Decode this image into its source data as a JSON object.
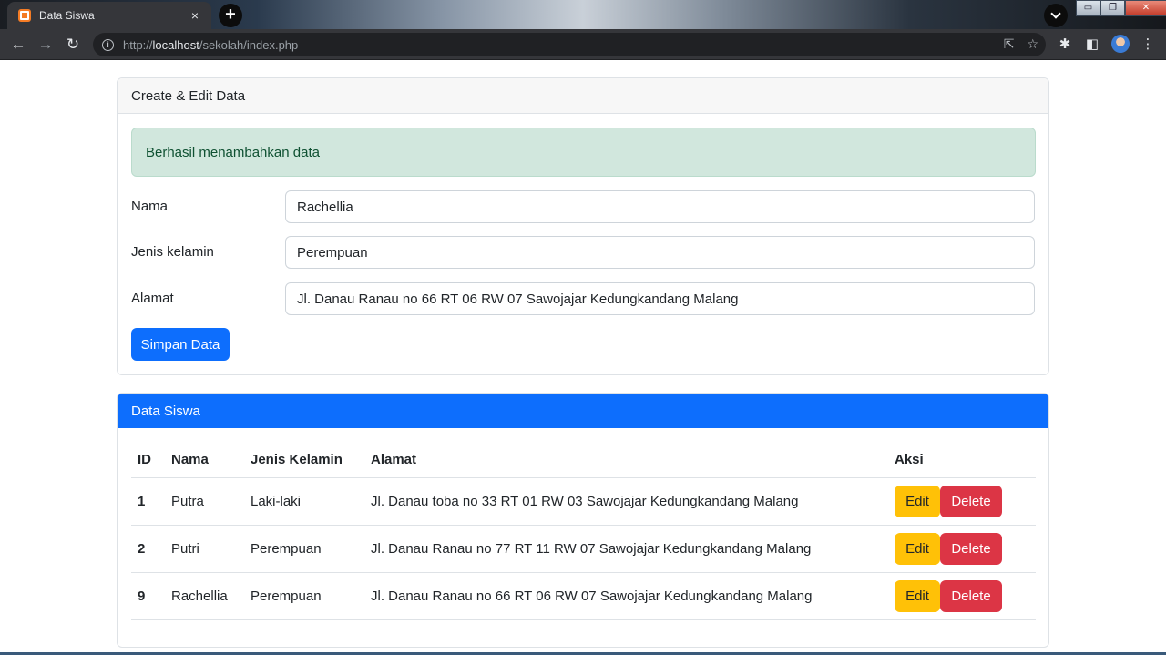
{
  "browser": {
    "tab_title": "Data Siswa",
    "tab_close": "×",
    "new_tab": "+",
    "url_scheme": "http://",
    "url_host": "localhost",
    "url_path": "/sekolah/index.php",
    "win_minimize": "▭",
    "win_maximize": "❐",
    "win_close": "✕"
  },
  "form_card": {
    "header": "Create & Edit Data",
    "alert": "Berhasil menambahkan data",
    "fields": [
      {
        "label": "Nama",
        "value": "Rachellia"
      },
      {
        "label": "Jenis kelamin",
        "value": "Perempuan"
      },
      {
        "label": "Alamat",
        "value": "Jl. Danau Ranau no 66 RT 06 RW 07 Sawojajar Kedungkandang Malang"
      }
    ],
    "submit_label": "Simpan Data"
  },
  "table_card": {
    "header": "Data Siswa",
    "columns": [
      "ID",
      "Nama",
      "Jenis Kelamin",
      "Alamat",
      "Aksi"
    ],
    "rows": [
      {
        "id": "1",
        "nama": "Putra",
        "jk": "Laki-laki",
        "alamat": "Jl. Danau toba no 33 RT 01 RW 03 Sawojajar Kedungkandang Malang"
      },
      {
        "id": "2",
        "nama": "Putri",
        "jk": "Perempuan",
        "alamat": "Jl. Danau Ranau no 77 RT 11 RW 07 Sawojajar Kedungkandang Malang"
      },
      {
        "id": "9",
        "nama": "Rachellia",
        "jk": "Perempuan",
        "alamat": "Jl. Danau Ranau no 66 RT 06 RW 07 Sawojajar Kedungkandang Malang"
      }
    ],
    "edit_label": "Edit",
    "delete_label": "Delete"
  },
  "colors": {
    "primary": "#0d6efd",
    "success_bg": "#d1e7dd",
    "warning": "#ffc107",
    "danger": "#dc3545"
  },
  "icons": [
    "xampp-favicon-icon",
    "back-arrow-icon",
    "forward-arrow-icon",
    "reload-icon",
    "info-icon",
    "share-icon",
    "star-icon",
    "extensions-icon",
    "side-panel-icon",
    "profile-avatar",
    "menu-dots-icon"
  ]
}
